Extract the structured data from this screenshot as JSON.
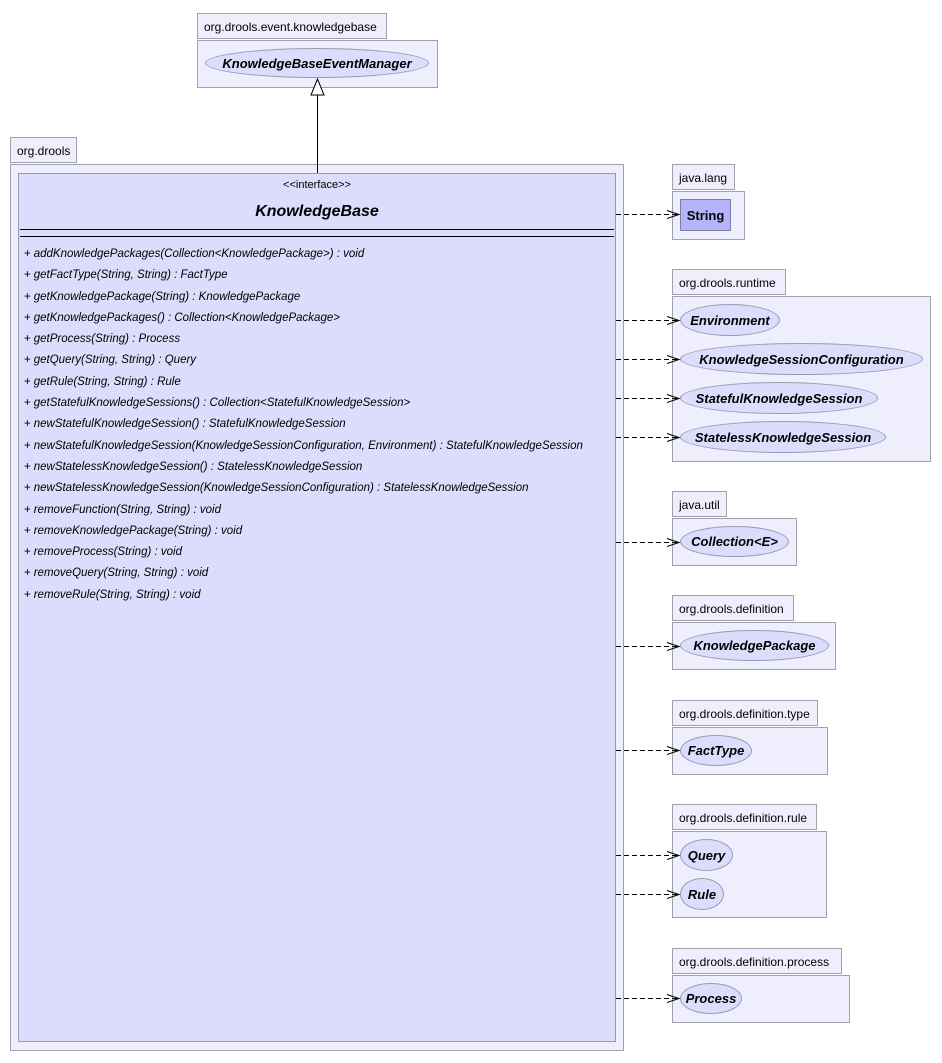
{
  "diagram": {
    "type": "uml-class",
    "packages": [
      {
        "id": "event-kb",
        "name": "org.drools.event.knowledgebase",
        "members": [
          "KnowledgeBaseEventManager"
        ]
      },
      {
        "id": "drools",
        "name": "org.drools",
        "members": [
          "KnowledgeBase"
        ]
      },
      {
        "id": "java-lang",
        "name": "java.lang",
        "members": [
          "String"
        ]
      },
      {
        "id": "runtime",
        "name": "org.drools.runtime",
        "members": [
          "Environment",
          "KnowledgeSessionConfiguration",
          "StatefulKnowledgeSession",
          "StatelessKnowledgeSession"
        ]
      },
      {
        "id": "java-util",
        "name": "java.util",
        "members": [
          "Collection<E>"
        ]
      },
      {
        "id": "definition",
        "name": "org.drools.definition",
        "members": [
          "KnowledgePackage"
        ]
      },
      {
        "id": "definition-type",
        "name": "org.drools.definition.type",
        "members": [
          "FactType"
        ]
      },
      {
        "id": "definition-rule",
        "name": "org.drools.definition.rule",
        "members": [
          "Query",
          "Rule"
        ]
      },
      {
        "id": "definition-process",
        "name": "org.drools.definition.process",
        "members": [
          "Process"
        ]
      }
    ],
    "main": {
      "stereotype": "<<interface>>",
      "name": "KnowledgeBase",
      "visibility": "+",
      "methods": [
        "addKnowledgePackages(Collection<KnowledgePackage>) : void",
        "getFactType(String, String) : FactType",
        "getKnowledgePackage(String) : KnowledgePackage",
        "getKnowledgePackages() : Collection<KnowledgePackage>",
        "getProcess(String) : Process",
        "getQuery(String, String) : Query",
        "getRule(String, String) : Rule",
        "getStatefulKnowledgeSessions() : Collection<StatefulKnowledgeSession>",
        "newStatefulKnowledgeSession() : StatefulKnowledgeSession",
        "newStatefulKnowledgeSession(KnowledgeSessionConfiguration, Environment) : StatefulKnowledgeSession",
        "newStatelessKnowledgeSession() : StatelessKnowledgeSession",
        "newStatelessKnowledgeSession(KnowledgeSessionConfiguration) : StatelessKnowledgeSession",
        "removeFunction(String, String) : void",
        "removeKnowledgePackage(String) : void",
        "removeProcess(String) : void",
        "removeQuery(String, String) : void",
        "removeRule(String, String) : void"
      ]
    },
    "types": {
      "KnowledgeBaseEventManager": "KnowledgeBaseEventManager",
      "String": "String",
      "Environment": "Environment",
      "KnowledgeSessionConfiguration": "KnowledgeSessionConfiguration",
      "StatefulKnowledgeSession": "StatefulKnowledgeSession",
      "StatelessKnowledgeSession": "StatelessKnowledgeSession",
      "Collection": "Collection<E>",
      "KnowledgePackage": "KnowledgePackage",
      "FactType": "FactType",
      "Query": "Query",
      "Rule": "Rule",
      "Process": "Process"
    },
    "relations": [
      {
        "kind": "generalization",
        "from": "KnowledgeBase",
        "to": "KnowledgeBaseEventManager"
      },
      {
        "kind": "dependency",
        "from": "KnowledgeBase",
        "to": "String"
      },
      {
        "kind": "dependency",
        "from": "KnowledgeBase",
        "to": "Environment"
      },
      {
        "kind": "dependency",
        "from": "KnowledgeBase",
        "to": "KnowledgeSessionConfiguration"
      },
      {
        "kind": "dependency",
        "from": "KnowledgeBase",
        "to": "StatefulKnowledgeSession"
      },
      {
        "kind": "dependency",
        "from": "KnowledgeBase",
        "to": "StatelessKnowledgeSession"
      },
      {
        "kind": "dependency",
        "from": "KnowledgeBase",
        "to": "Collection<E>"
      },
      {
        "kind": "dependency",
        "from": "KnowledgeBase",
        "to": "KnowledgePackage"
      },
      {
        "kind": "dependency",
        "from": "KnowledgeBase",
        "to": "FactType"
      },
      {
        "kind": "dependency",
        "from": "KnowledgeBase",
        "to": "Query"
      },
      {
        "kind": "dependency",
        "from": "KnowledgeBase",
        "to": "Rule"
      },
      {
        "kind": "dependency",
        "from": "KnowledgeBase",
        "to": "Process"
      }
    ]
  }
}
